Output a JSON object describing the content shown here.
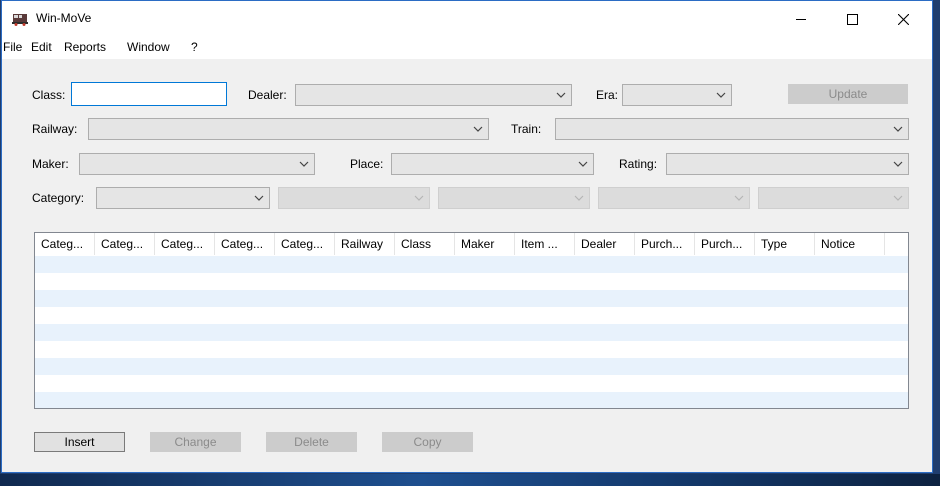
{
  "window": {
    "title": "Win-MoVe",
    "controls": [
      "minimize",
      "maximize",
      "close"
    ]
  },
  "menu": [
    "File",
    "Edit",
    "Reports",
    "Window",
    "?"
  ],
  "filters": {
    "class_label": "Class:",
    "class_value": "",
    "dealer_label": "Dealer:",
    "dealer_value": "",
    "era_label": "Era:",
    "era_value": "",
    "update_label": "Update",
    "railway_label": "Railway:",
    "railway_value": "",
    "train_label": "Train:",
    "train_value": "",
    "maker_label": "Maker:",
    "maker_value": "",
    "place_label": "Place:",
    "place_value": "",
    "rating_label": "Rating:",
    "rating_value": "",
    "category_label": "Category:",
    "category_value": ""
  },
  "table": {
    "columns": [
      "Categ...",
      "Categ...",
      "Categ...",
      "Categ...",
      "Categ...",
      "Railway",
      "Class",
      "Maker",
      "Item ...",
      "Dealer",
      "Purch...",
      "Purch...",
      "Type",
      "Notice"
    ],
    "rows": []
  },
  "actions": {
    "insert": "Insert",
    "change": "Change",
    "delete": "Delete",
    "copy": "Copy"
  },
  "colors": {
    "window_border": "#2b6cc4",
    "focus_border": "#0078d7",
    "row_alt": "#e8f2fc"
  }
}
